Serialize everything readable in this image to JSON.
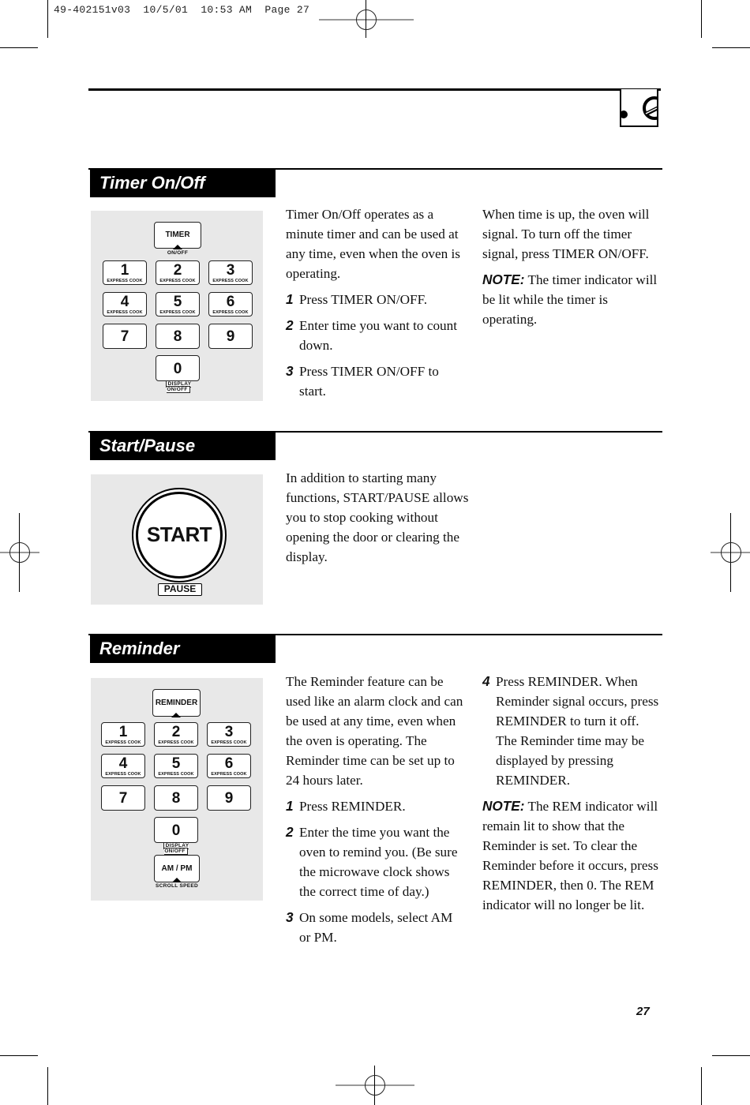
{
  "slug_line": "49-402151v03  10/5/01  10:53 AM  Page 27",
  "sections": {
    "timer": {
      "title": "Timer On/Off",
      "keypad": {
        "top_key": "TIMER",
        "top_caption": "ON/OFF",
        "keys": [
          {
            "num": "1",
            "sub": "EXPRESS COOK"
          },
          {
            "num": "2",
            "sub": "EXPRESS COOK"
          },
          {
            "num": "3",
            "sub": "EXPRESS COOK"
          },
          {
            "num": "4",
            "sub": "EXPRESS COOK"
          },
          {
            "num": "5",
            "sub": "EXPRESS COOK"
          },
          {
            "num": "6",
            "sub": "EXPRESS COOK"
          },
          {
            "num": "7",
            "sub": ""
          },
          {
            "num": "8",
            "sub": ""
          },
          {
            "num": "9",
            "sub": ""
          }
        ],
        "zero_key": "0",
        "zero_caption": "DISPLAY ON/OFF"
      },
      "intro": "Timer On/Off operates as a minute timer and can be used at any time, even when the oven is operating.",
      "steps": [
        {
          "n": "1",
          "text": "Press TIMER ON/OFF."
        },
        {
          "n": "2",
          "text": "Enter time you want to count down."
        },
        {
          "n": "3",
          "text": "Press TIMER ON/OFF to start."
        }
      ],
      "col2_para": "When time is up, the oven will signal. To turn off the timer signal, press TIMER ON/OFF.",
      "note_label": "NOTE:",
      "note_text": " The timer indicator will be lit while the timer is operating."
    },
    "start": {
      "title": "Start/Pause",
      "button_label": "START",
      "button_caption": "PAUSE",
      "text": "In addition to starting many functions, START/PAUSE allows you to stop cooking without opening the door or clearing the display."
    },
    "reminder": {
      "title": "Reminder",
      "keypad": {
        "top_key": "REMINDER",
        "keys": [
          {
            "num": "1",
            "sub": "EXPRESS COOK"
          },
          {
            "num": "2",
            "sub": "EXPRESS COOK"
          },
          {
            "num": "3",
            "sub": "EXPRESS COOK"
          },
          {
            "num": "4",
            "sub": "EXPRESS COOK"
          },
          {
            "num": "5",
            "sub": "EXPRESS COOK"
          },
          {
            "num": "6",
            "sub": "EXPRESS COOK"
          },
          {
            "num": "7",
            "sub": ""
          },
          {
            "num": "8",
            "sub": ""
          },
          {
            "num": "9",
            "sub": ""
          }
        ],
        "zero_key": "0",
        "zero_caption": "DISPLAY ON/OFF",
        "ampm_key": "AM / PM",
        "ampm_caption": "SCROLL SPEED"
      },
      "intro": "The Reminder feature can be used like an alarm clock and can be used at any time, even when the oven is operating. The Reminder time can be set up to 24 hours later.",
      "steps": [
        {
          "n": "1",
          "text": "Press REMINDER."
        },
        {
          "n": "2",
          "text": "Enter the time you want the oven to remind you. (Be sure the microwave clock shows the correct time of day.)"
        },
        {
          "n": "3",
          "text": "On some models, select AM or PM."
        },
        {
          "n": "4",
          "text": "Press REMINDER. When Reminder signal occurs, press REMINDER to turn it off. The Reminder time may be displayed by pressing REMINDER."
        }
      ],
      "note_label": "NOTE:",
      "note_text": " The REM indicator will remain lit to show that the Reminder is set. To clear the Reminder before it occurs, press REMINDER, then 0. The REM indicator will no longer be lit."
    }
  },
  "page_number": "27"
}
